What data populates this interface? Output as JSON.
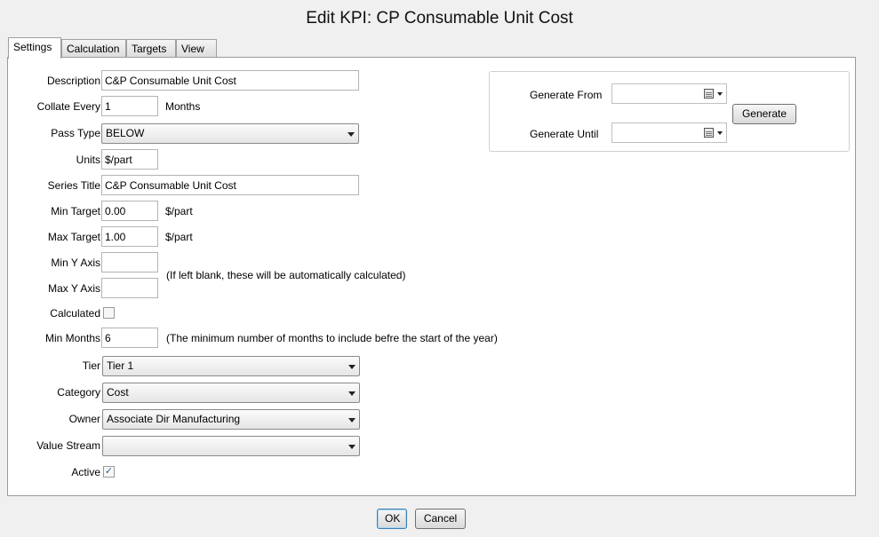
{
  "dialog": {
    "title": "Edit KPI: CP Consumable Unit Cost"
  },
  "tabs": [
    {
      "label": "Settings",
      "active": true
    },
    {
      "label": "Calculation",
      "active": false
    },
    {
      "label": "Targets",
      "active": false
    },
    {
      "label": "View",
      "active": false
    }
  ],
  "form": {
    "description": {
      "label": "Description",
      "value": "C&P Consumable Unit Cost"
    },
    "collate_every": {
      "label": "Collate Every",
      "value": "1",
      "unit": "Months"
    },
    "pass_type": {
      "label": "Pass Type",
      "value": "BELOW"
    },
    "units": {
      "label": "Units",
      "value": "$/part"
    },
    "series_title": {
      "label": "Series Title",
      "value": "C&P Consumable Unit Cost"
    },
    "min_target": {
      "label": "Min Target",
      "value": "0.00",
      "unit": "$/part"
    },
    "max_target": {
      "label": "Max Target",
      "value": "1.00",
      "unit": "$/part"
    },
    "min_y_axis": {
      "label": "Min Y Axis",
      "value": ""
    },
    "max_y_axis": {
      "label": "Max Y Axis",
      "value": ""
    },
    "y_axis_hint": "(If left blank, these will be automatically calculated)",
    "calculated": {
      "label": "Calculated",
      "checked": false
    },
    "min_months": {
      "label": "Min Months",
      "value": "6",
      "hint": "(The minimum number of months to include befre the start of the year)"
    },
    "tier": {
      "label": "Tier",
      "value": "Tier 1"
    },
    "category": {
      "label": "Category",
      "value": "Cost"
    },
    "owner": {
      "label": "Owner",
      "value": "Associate Dir Manufacturing"
    },
    "value_stream": {
      "label": "Value Stream",
      "value": ""
    },
    "active": {
      "label": "Active",
      "checked": true,
      "mark": "✓"
    }
  },
  "generate": {
    "from_label": "Generate From",
    "until_label": "Generate Until",
    "from_value": "",
    "until_value": "",
    "button_label": "Generate"
  },
  "footer": {
    "ok_label": "OK",
    "cancel_label": "Cancel"
  }
}
